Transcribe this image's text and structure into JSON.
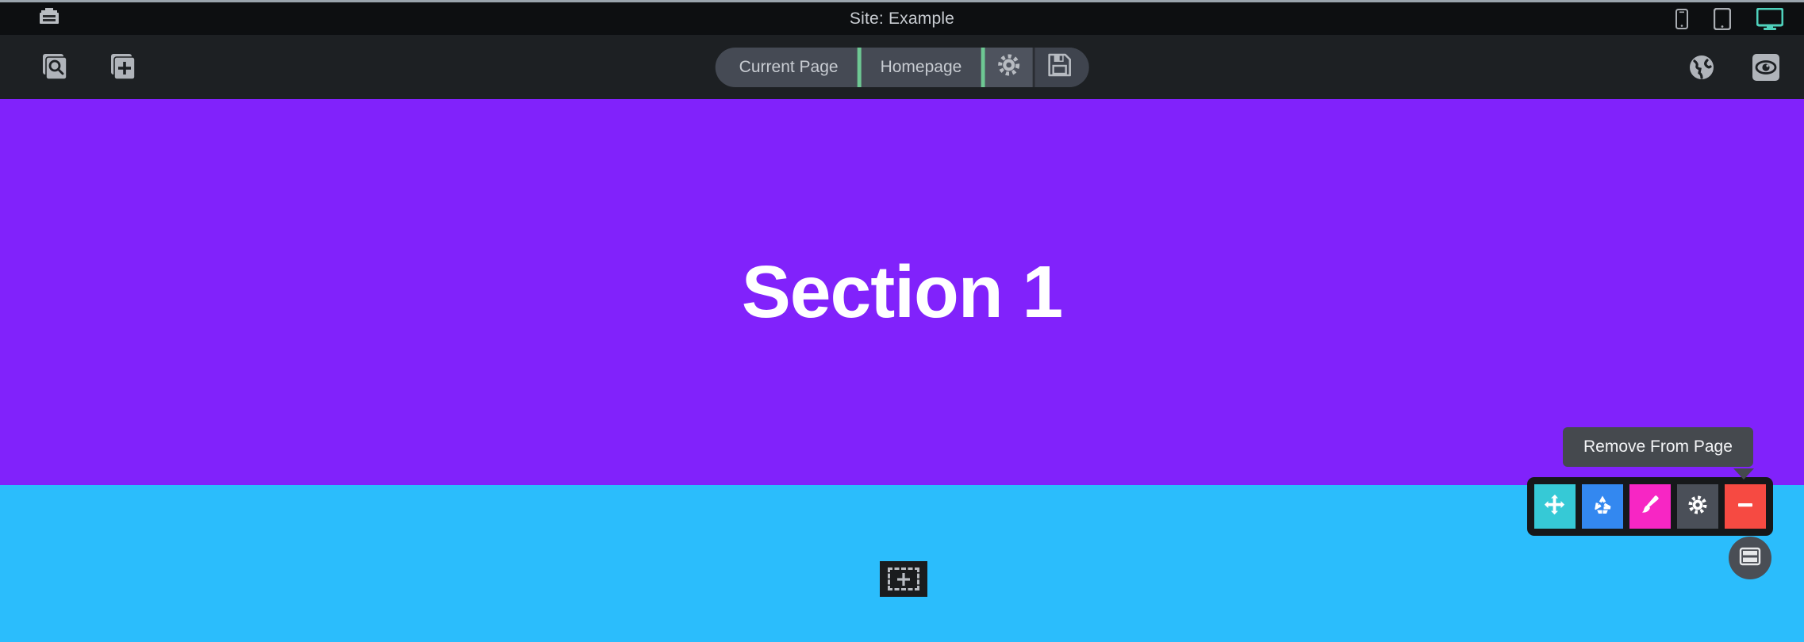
{
  "titlebar": {
    "toolbox_icon": "toolbox-icon",
    "title": "Site: Example",
    "devices": [
      {
        "name": "mobile",
        "icon": "phone-icon",
        "active": false
      },
      {
        "name": "tablet",
        "icon": "tablet-icon",
        "active": false
      },
      {
        "name": "desktop",
        "icon": "desktop-icon",
        "active": true
      }
    ]
  },
  "toolbar": {
    "left_buttons": [
      {
        "name": "find-page",
        "icon": "pages-search-icon"
      },
      {
        "name": "add-page",
        "icon": "pages-plus-icon"
      }
    ],
    "pill": {
      "tab_current_page": "Current Page",
      "tab_homepage": "Homepage",
      "settings_icon": "gear-icon",
      "save_icon": "floppy-save-icon"
    },
    "right_buttons": [
      {
        "name": "globe",
        "icon": "globe-icon"
      },
      {
        "name": "preview",
        "icon": "eye-icon"
      }
    ]
  },
  "canvas": {
    "sections": [
      {
        "name": "section-1",
        "heading": "Section 1",
        "color": "#8122fb"
      },
      {
        "name": "section-2",
        "heading": "",
        "color": "#2bbdfc"
      }
    ],
    "add_section_icon": "plus-icon"
  },
  "action_toolbar": {
    "tooltip": "Remove From Page",
    "buttons": [
      {
        "name": "move",
        "icon": "move-arrows-icon",
        "color": "#36c9d6"
      },
      {
        "name": "duplicate",
        "icon": "recycle-icon",
        "color": "#3388f0"
      },
      {
        "name": "style",
        "icon": "paintbrush-icon",
        "color": "#f726c4"
      },
      {
        "name": "settings",
        "icon": "gear-icon",
        "color": "#4a4f58"
      },
      {
        "name": "remove",
        "icon": "minus-icon",
        "color": "#f64a42"
      }
    ]
  },
  "fab": {
    "name": "layout-rows",
    "icon": "rows-layout-icon"
  },
  "colors": {
    "accent_green": "#6ec893",
    "active_device": "#4fd1bc",
    "toolbar_bg": "#1d2023",
    "titlebar_bg": "#0d0f11",
    "pill_bg": "#454a54"
  }
}
